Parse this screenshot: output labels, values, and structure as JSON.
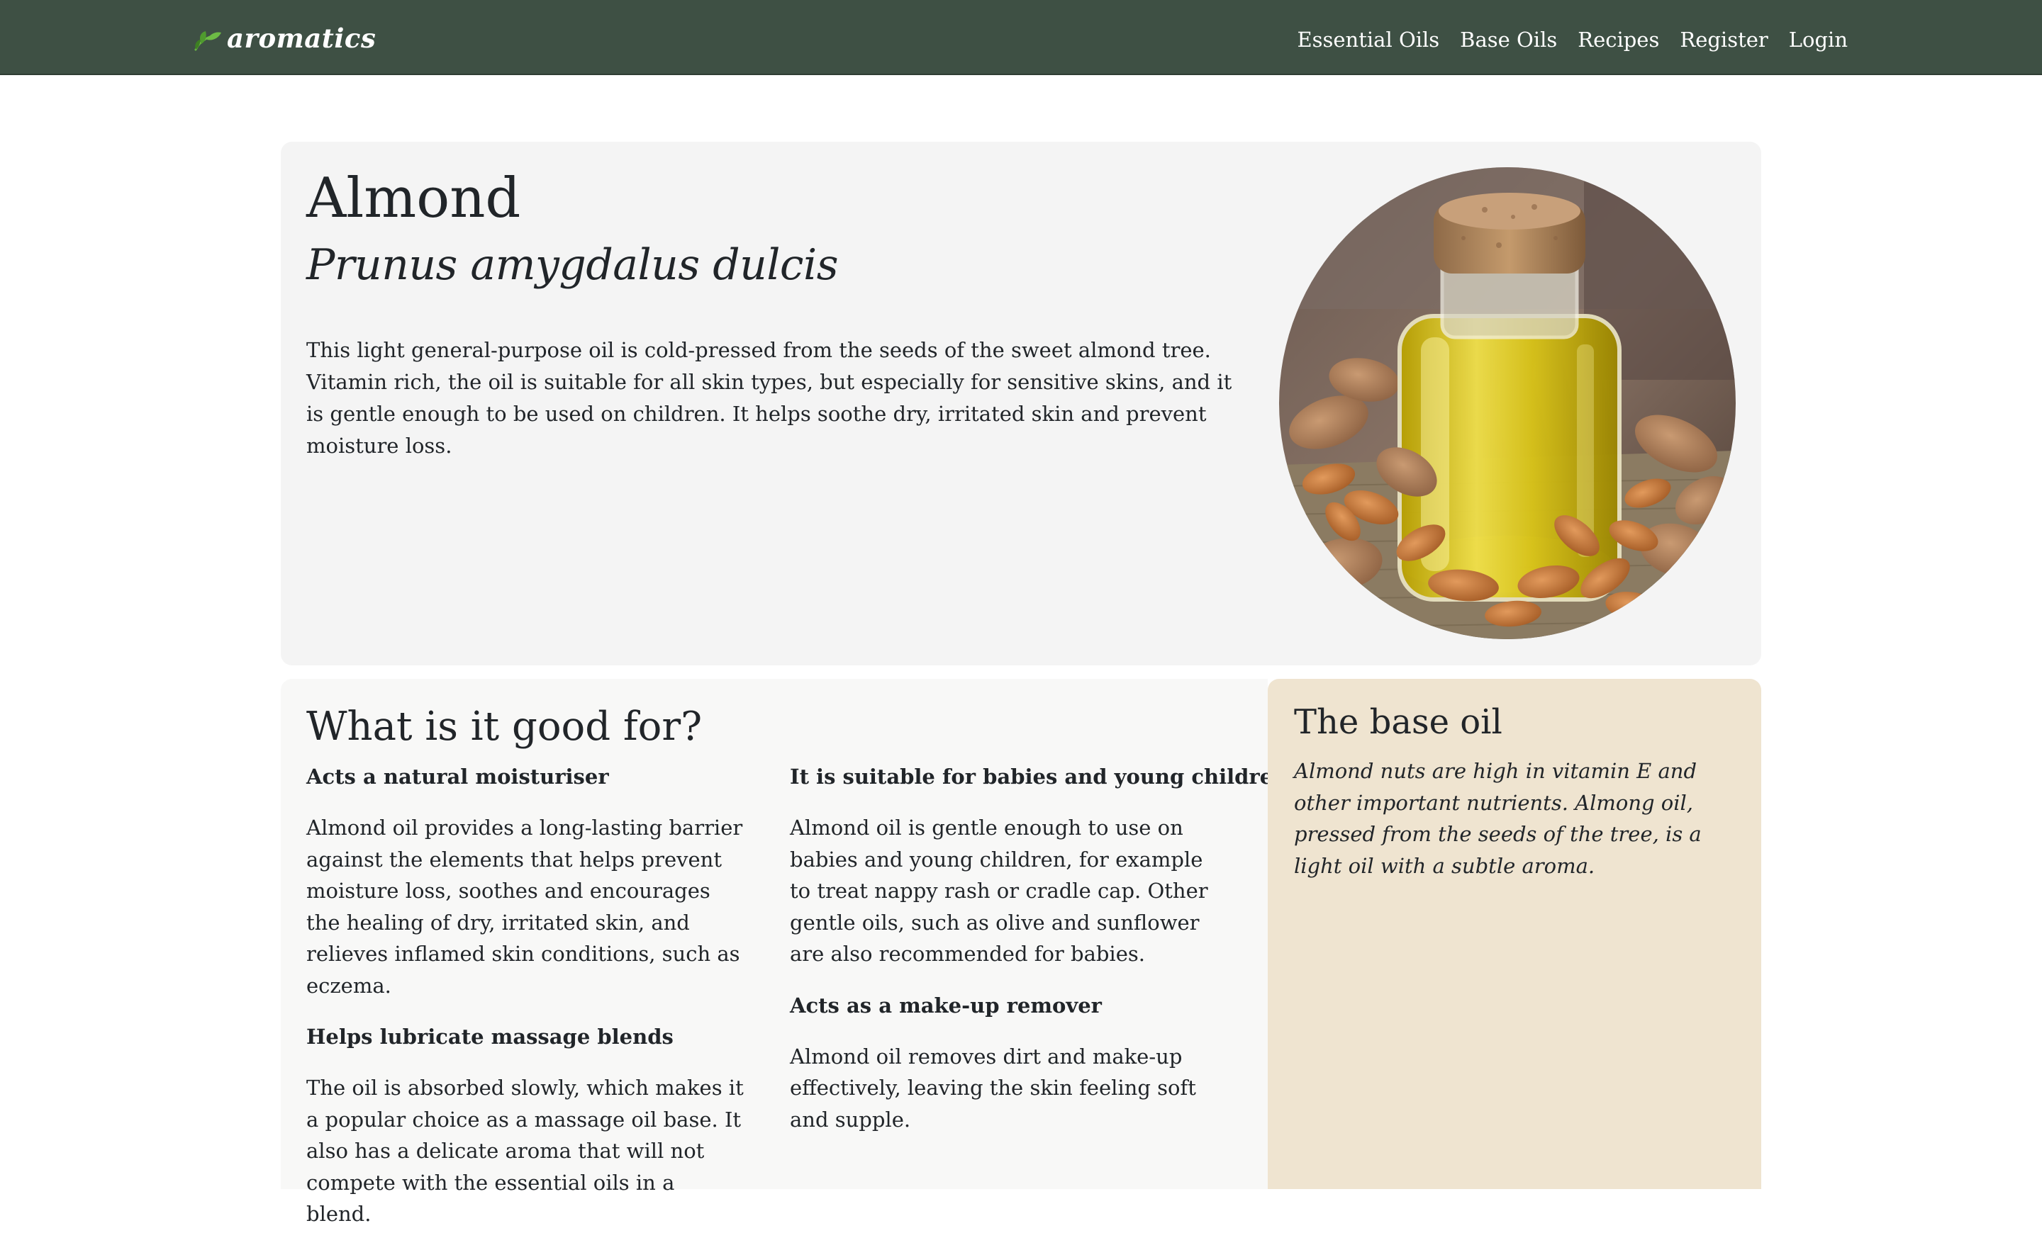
{
  "nav": {
    "brand": "aromatics",
    "links": [
      "Essential Oils",
      "Base Oils",
      "Recipes",
      "Register",
      "Login"
    ]
  },
  "hero": {
    "title": "Almond",
    "subtitle": "Prunus amygdalus dulcis",
    "description": "This light general-purpose oil is cold-pressed from the seeds of the sweet almond tree. Vitamin rich, the oil is suitable for all skin types, but especially for sensitive skins, and it is gentle enough to be used on children. It helps soothe dry, irritated skin and prevent moisture loss."
  },
  "benefits": {
    "title": "What is it good for?",
    "items": [
      {
        "heading": "Acts a natural moisturiser",
        "text": "Almond oil provides a long-lasting barrier against the elements that helps prevent moisture loss, soothes and encourages the healing of dry, irritated skin, and relieves inflamed skin conditions, such as eczema."
      },
      {
        "heading": "Helps lubricate massage blends",
        "text": "The oil is absorbed slowly, which makes it a popular choice as a massage oil base. It also has a delicate aroma that will not compete with the essential oils in a blend."
      },
      {
        "heading": "It is suitable for babies and young children",
        "text": "Almond oil is gentle enough to use on babies and young children, for example to treat nappy rash or cradle cap. Other gentle oils, such as olive and sunflower are also recommended for babies."
      },
      {
        "heading": "Acts as a make-up remover",
        "text": "Almond oil removes dirt and make-up effectively, leaving the skin feeling soft and supple."
      }
    ]
  },
  "base_oil": {
    "title": "The base oil",
    "text": "Almond nuts are high in vitamin E and other important nutrients. Almong oil, pressed from the seeds of the tree, is a light oil with a subtle aroma."
  },
  "colors": {
    "navbar": "#3e5044",
    "hero_bg": "#f4f4f4",
    "benefits_bg": "#f8f8f7",
    "base_oil_bg": "#efe4d0",
    "text": "#212529",
    "brand_leaf": "#5fa83a"
  },
  "icons": {
    "brand": "leaf-icon"
  }
}
